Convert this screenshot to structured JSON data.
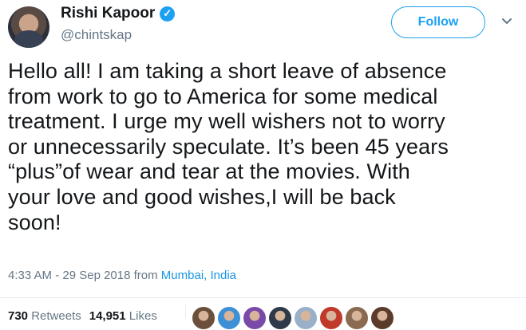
{
  "author": {
    "name": "Rishi Kapoor",
    "handle": "@chintskap",
    "verified_icon": "verified-badge-icon"
  },
  "follow_label": "Follow",
  "tweet": {
    "text": "Hello all! I am taking a short leave of absence\nfrom work to go to America for some medical\ntreatment. I urge my well wishers not to worry\nor unnecessarily speculate. It’s been 45 years\n“plus”of wear and tear at the movies. With\nyour love and good wishes,I  will be back\nsoon!",
    "time": "4:33 AM - 29 Sep 2018",
    "from_label": "from",
    "location": "Mumbai, India"
  },
  "stats": {
    "retweets_count": "730",
    "retweets_label": "Retweets",
    "likes_count": "14,951",
    "likes_label": "Likes"
  },
  "colors": {
    "accent": "#1da1f2",
    "text": "#14171a",
    "muted": "#657786"
  },
  "liker_avatars": [
    "#6b4f3a",
    "#3d8fd6",
    "#7a4aa8",
    "#2e3a4a",
    "#9ab0c8",
    "#c0392b",
    "#8a6b52",
    "#5b3b2a"
  ]
}
